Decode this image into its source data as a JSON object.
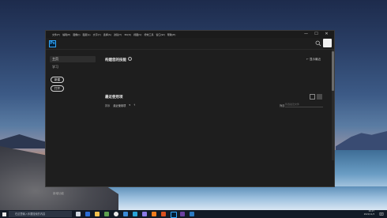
{
  "window": {
    "app_logo": "Ps",
    "menu": [
      "文件(F)",
      "编辑(E)",
      "图像(I)",
      "图层(L)",
      "文字(Y)",
      "选择(S)",
      "滤镜(T)",
      "3D(D)",
      "视图(V)",
      "增效工具",
      "窗口(W)",
      "帮助(H)"
    ],
    "controls": {
      "minimize": "—",
      "maximize": "☐",
      "close": "✕"
    }
  },
  "sidebar": {
    "items": [
      {
        "label": "主页",
        "active": true
      },
      {
        "label": "学习",
        "active": false
      }
    ],
    "new_button": "新建",
    "open_button": "打开",
    "footer": "新增功能"
  },
  "main": {
    "learn_title": "构建您的技能",
    "show_all": "显示最近",
    "recent_title": "最近使用项",
    "sort_label": "排序",
    "sort_value": "最近使用项",
    "filter_label": "筛选",
    "filter_placeholder": "筛选最近文件"
  },
  "taskbar": {
    "search_placeholder": "在这里输入你要搜索的内容",
    "time": "16:27",
    "date": "2021/11/3"
  },
  "icons": {
    "search": "search-icon",
    "info": "info-icon",
    "grid_view": "grid-view-icon",
    "list_view": "list-view-icon",
    "start": "windows-start-icon"
  },
  "colors": {
    "ps_blue": "#31a8ff",
    "ps_dark": "#001e36",
    "panel_bg": "#1e1e1e"
  }
}
